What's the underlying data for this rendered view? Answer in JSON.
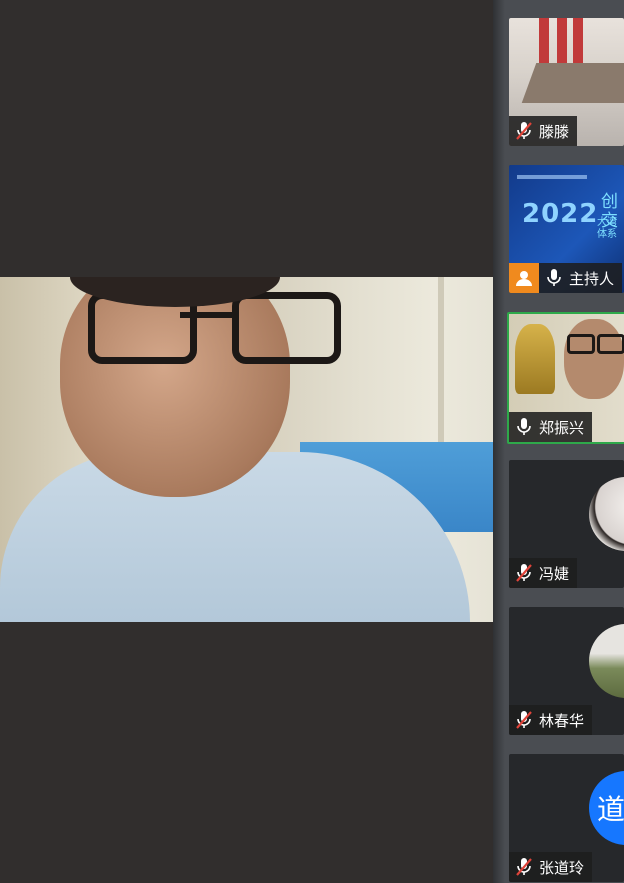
{
  "main_video": {
    "speaker": "郑振兴"
  },
  "participants": [
    {
      "name": "滕滕",
      "muted": true,
      "host": false,
      "active": false,
      "thumb": "conference-room"
    },
    {
      "name": "主持人",
      "muted": false,
      "host": true,
      "active": false,
      "thumb": "slide"
    },
    {
      "name": "郑振兴",
      "muted": false,
      "host": false,
      "active": true,
      "thumb": "camera"
    },
    {
      "name": "冯婕",
      "muted": true,
      "host": false,
      "active": false,
      "thumb": "avatar-photo"
    },
    {
      "name": "林春华",
      "muted": true,
      "host": false,
      "active": false,
      "thumb": "avatar-photo"
    },
    {
      "name": "张道玲",
      "muted": true,
      "host": false,
      "active": false,
      "thumb": "avatar-initial",
      "initial": "道"
    }
  ],
  "slide": {
    "year": "2022",
    "line1": "创交",
    "line2": "大湾",
    "line3": "体系"
  },
  "colors": {
    "active_border": "#2ea94a",
    "host_badge": "#f08a1e",
    "avatar_blue": "#1677ff",
    "muted_icon": "#e0443a"
  },
  "icons": {
    "mic": "microphone-icon",
    "mic_off": "microphone-muted-icon",
    "host": "host-user-icon"
  }
}
